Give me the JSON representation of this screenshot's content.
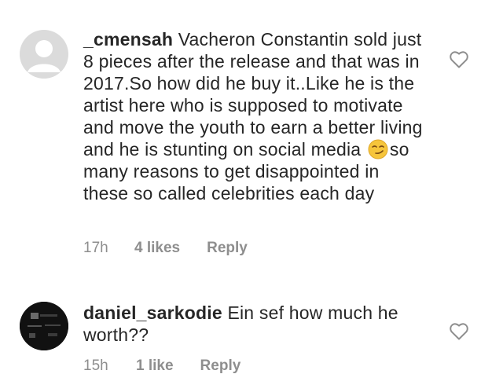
{
  "comments": [
    {
      "username": "_cmensah",
      "text_before_emoji": "Vacheron Constantin sold just 8 pieces after the release and that was in 2017.So how did he buy it..Like he is the artist here who is supposed to motivate and move the youth to earn a better living and he is stunting on social media",
      "emoji": "smirking-face-emoji",
      "text_after_emoji": "so many reasons to get disappointed in these so called celebrities each day",
      "time": "17h",
      "likes": "4 likes",
      "reply_label": "Reply",
      "avatar": "default-avatar-icon",
      "heart": "heart-outline-icon"
    },
    {
      "username": "daniel_sarkodie",
      "text": "Ein sef how much he worth??",
      "time": "15h",
      "likes": "1 like",
      "reply_label": "Reply",
      "avatar": "user-photo-avatar",
      "heart": "heart-outline-icon"
    }
  ],
  "colors": {
    "text": "#262626",
    "meta": "#8e8e8e",
    "avatar_default_bg": "#dbdbdb"
  }
}
